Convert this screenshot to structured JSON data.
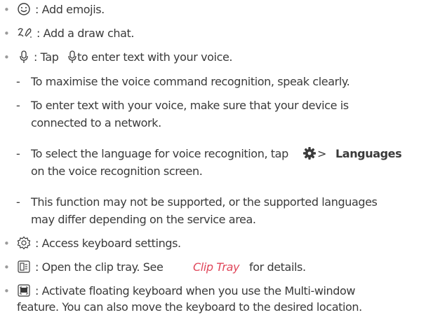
{
  "items": [
    {
      "icon": "emoji-icon",
      "text": ": Add emojis."
    },
    {
      "icon": "draw-chat-icon",
      "text": ": Add a draw chat."
    },
    {
      "icon": "microphone-icon",
      "text_a": ": Tap ",
      "text_b": " to enter text with your voice.",
      "subitems": [
        {
          "lines": [
            "To maximise the voice command recognition, speak clearly."
          ]
        },
        {
          "lines": [
            "To enter text with your voice, make sure that your device is",
            "connected to a network."
          ]
        },
        {
          "line1_a": "To select the language for voice recognition, tap ",
          "line1_mid": " > ",
          "line1_bold": "Languages",
          "line2": "on the voice recognition screen."
        },
        {
          "lines": [
            "This function may not be supported, or the supported languages",
            "may differ depending on the service area."
          ]
        }
      ]
    },
    {
      "icon": "settings-icon",
      "text": ": Access keyboard settings."
    },
    {
      "icon": "clip-tray-icon",
      "text_a": ": Open the clip tray. See ",
      "link": "Clip Tray",
      "text_b": " for details."
    },
    {
      "icon": "floating-keyboard-icon",
      "lines": [
        ": Activate floating keyboard when you use the Multi-window",
        "feature. You can also move the keyboard to the desired location."
      ]
    }
  ],
  "bullet_char": "•",
  "dash_char": "-",
  "colors": {
    "text": "#3a3a3a",
    "link": "#e0475b",
    "bullet": "#9a9a9a"
  }
}
